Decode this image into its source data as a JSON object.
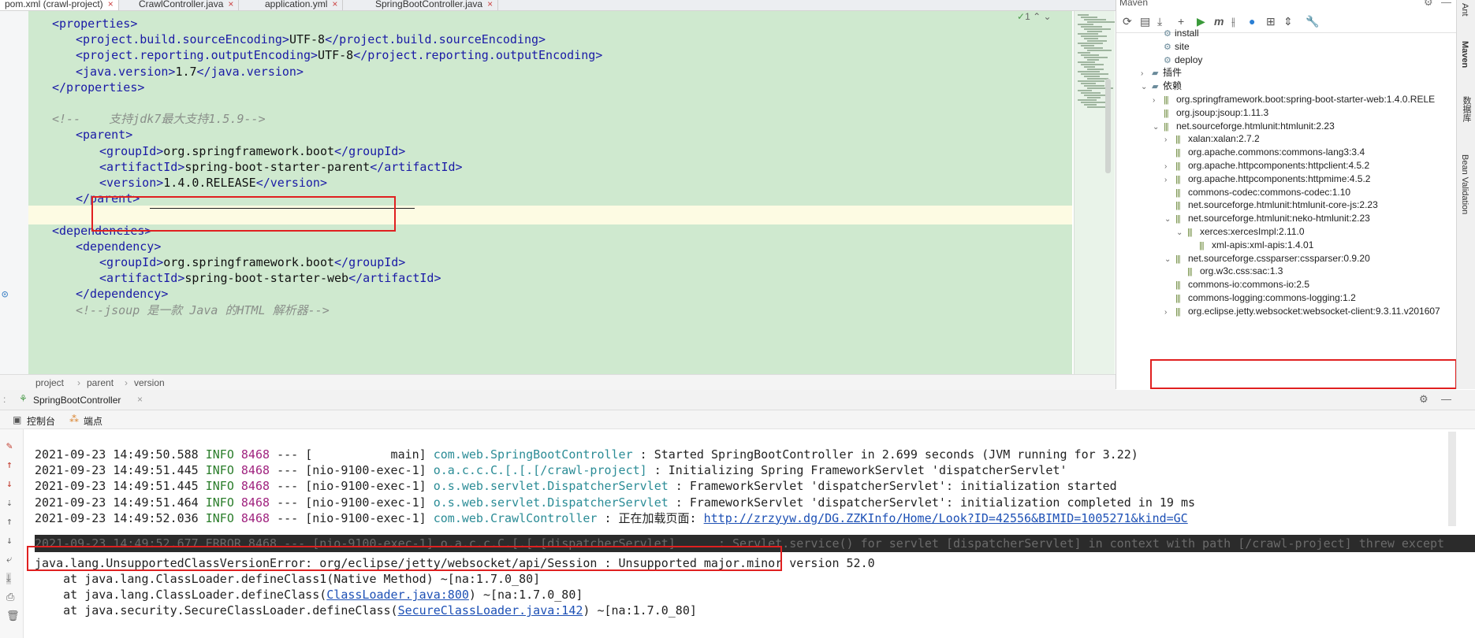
{
  "tabs": [
    {
      "label": "pom.xml (crawl-project)",
      "active": true
    },
    {
      "label": "CrawlController.java"
    },
    {
      "label": "application.yml"
    },
    {
      "label": "SpringBootController.java"
    }
  ],
  "editor": {
    "lines": [
      {
        "indent": 1,
        "open": "<properties>",
        "text": "",
        "close": ""
      },
      {
        "indent": 2,
        "open": "<project.build.sourceEncoding>",
        "text": "UTF-8",
        "close": "</project.build.sourceEncoding>"
      },
      {
        "indent": 2,
        "open": "<project.reporting.outputEncoding>",
        "text": "UTF-8",
        "close": "</project.reporting.outputEncoding>"
      },
      {
        "indent": 2,
        "open": "<java.version>",
        "text": "1.7",
        "close": "</java.version>"
      },
      {
        "indent": 1,
        "open": "</properties>",
        "text": "",
        "close": ""
      },
      {
        "indent": 0,
        "open": "",
        "text": "",
        "close": ""
      },
      {
        "indent": 1,
        "comment": "<!--    支持jdk7最大支持1.5.9-->"
      },
      {
        "indent": 2,
        "open": "<parent>",
        "text": "",
        "close": ""
      },
      {
        "indent": 3,
        "open": "<groupId>",
        "text": "org.springframework.boot",
        "close": "</groupId>"
      },
      {
        "indent": 3,
        "open": "<artifactId>",
        "text": "spring-boot-starter-parent",
        "close": "</artifactId>"
      },
      {
        "indent": 3,
        "open": "<version>",
        "text": "1.4.0.RELEASE",
        "close": "</version>"
      },
      {
        "indent": 2,
        "open": "</parent>",
        "text": "",
        "close": ""
      },
      {
        "indent": 0,
        "open": "",
        "text": "",
        "close": ""
      },
      {
        "indent": 1,
        "open": "<dependencies>",
        "text": "",
        "close": ""
      },
      {
        "indent": 2,
        "open": "<dependency>",
        "text": "",
        "close": ""
      },
      {
        "indent": 3,
        "open": "<groupId>",
        "text": "org.springframework.boot",
        "close": "</groupId>"
      },
      {
        "indent": 3,
        "open": "<artifactId>",
        "text": "spring-boot-starter-web",
        "close": "</artifactId>"
      },
      {
        "indent": 2,
        "open": "</dependency>",
        "text": "",
        "close": ""
      },
      {
        "indent": 2,
        "comment": "<!--jsoup 是一款 Java 的HTML 解析器-->"
      }
    ],
    "inspection": "1",
    "breadcrumb": [
      "project",
      "parent",
      "version"
    ]
  },
  "maven": {
    "title": "Maven",
    "items": [
      {
        "level": 2,
        "arrow": "",
        "icon": "gear",
        "label": "install"
      },
      {
        "level": 2,
        "arrow": "",
        "icon": "gear",
        "label": "site"
      },
      {
        "level": 2,
        "arrow": "",
        "icon": "gear",
        "label": "deploy"
      },
      {
        "level": 1,
        "arrow": ">",
        "icon": "folder",
        "label": "插件"
      },
      {
        "level": 1,
        "arrow": "v",
        "icon": "folder",
        "label": "依赖"
      },
      {
        "level": 2,
        "arrow": ">",
        "icon": "lib",
        "label": "org.springframework.boot:spring-boot-starter-web:1.4.0.RELE"
      },
      {
        "level": 2,
        "arrow": "",
        "icon": "lib",
        "label": "org.jsoup:jsoup:1.11.3"
      },
      {
        "level": 2,
        "arrow": "v",
        "icon": "lib",
        "label": "net.sourceforge.htmlunit:htmlunit:2.23"
      },
      {
        "level": 3,
        "arrow": ">",
        "icon": "lib",
        "label": "xalan:xalan:2.7.2"
      },
      {
        "level": 3,
        "arrow": "",
        "icon": "lib",
        "label": "org.apache.commons:commons-lang3:3.4"
      },
      {
        "level": 3,
        "arrow": ">",
        "icon": "lib",
        "label": "org.apache.httpcomponents:httpclient:4.5.2"
      },
      {
        "level": 3,
        "arrow": ">",
        "icon": "lib",
        "label": "org.apache.httpcomponents:httpmime:4.5.2"
      },
      {
        "level": 3,
        "arrow": "",
        "icon": "lib",
        "label": "commons-codec:commons-codec:1.10"
      },
      {
        "level": 3,
        "arrow": "",
        "icon": "lib",
        "label": "net.sourceforge.htmlunit:htmlunit-core-js:2.23"
      },
      {
        "level": 3,
        "arrow": "v",
        "icon": "lib",
        "label": "net.sourceforge.htmlunit:neko-htmlunit:2.23"
      },
      {
        "level": 4,
        "arrow": "v",
        "icon": "lib",
        "label": "xerces:xercesImpl:2.11.0"
      },
      {
        "level": 5,
        "arrow": "",
        "icon": "lib",
        "label": "xml-apis:xml-apis:1.4.01"
      },
      {
        "level": 3,
        "arrow": "v",
        "icon": "lib",
        "label": "net.sourceforge.cssparser:cssparser:0.9.20"
      },
      {
        "level": 4,
        "arrow": "",
        "icon": "lib",
        "label": "org.w3c.css:sac:1.3"
      },
      {
        "level": 3,
        "arrow": "",
        "icon": "lib",
        "label": "commons-io:commons-io:2.5"
      },
      {
        "level": 3,
        "arrow": "",
        "icon": "lib",
        "label": "commons-logging:commons-logging:1.2"
      },
      {
        "level": 3,
        "arrow": ">",
        "icon": "lib",
        "label": "org.eclipse.jetty.websocket:websocket-client:9.3.11.v201607"
      }
    ]
  },
  "rightStrip": [
    "Ant",
    "Maven",
    "数据库",
    "Bean Validation"
  ],
  "run": {
    "title": "SpringBootController",
    "tabs": [
      "控制台",
      "端点"
    ],
    "logs": [
      {
        "time": "2021-09-23 14:49:50.588",
        "level": "INFO",
        "pid": "8468",
        "sep": "---",
        "thread": "[           main]",
        "logger": "com.web.SpringBootController",
        "msg": ": Started SpringBootController in 2.699 seconds (JVM running for 3.22)"
      },
      {
        "time": "2021-09-23 14:49:51.445",
        "level": "INFO",
        "pid": "8468",
        "sep": "---",
        "thread": "[nio-9100-exec-1]",
        "logger": "o.a.c.c.C.[.[.[/crawl-project]",
        "msg": ": Initializing Spring FrameworkServlet 'dispatcherServlet'"
      },
      {
        "time": "2021-09-23 14:49:51.445",
        "level": "INFO",
        "pid": "8468",
        "sep": "---",
        "thread": "[nio-9100-exec-1]",
        "logger": "o.s.web.servlet.DispatcherServlet",
        "msg": ": FrameworkServlet 'dispatcherServlet': initialization started"
      },
      {
        "time": "2021-09-23 14:49:51.464",
        "level": "INFO",
        "pid": "8468",
        "sep": "---",
        "thread": "[nio-9100-exec-1]",
        "logger": "o.s.web.servlet.DispatcherServlet",
        "msg": ": FrameworkServlet 'dispatcherServlet': initialization completed in 19 ms"
      },
      {
        "time": "2021-09-23 14:49:52.036",
        "level": "INFO",
        "pid": "8468",
        "sep": "---",
        "thread": "[nio-9100-exec-1]",
        "logger": "com.web.CrawlController",
        "msg": ": 正在加载页面:",
        "link": "http://zrzyyw.dg/DG.ZZKInfo/Home/Look?ID=42556&BIMID=1005271&kind=GC"
      }
    ],
    "errorLine": "2021-09-23 14:49:52.677 ERROR 8468 --- [nio-9100-exec-1] o.a.c.c.C.[.[.[dispatcherServlet]      : Servlet.service() for servlet [dispatcherServlet] in context with path [/crawl-project] threw except",
    "exception": "java.lang.UnsupportedClassVersionError: org/eclipse/jetty/websocket/api/Session : Unsupported major.minor version 52.0",
    "stack": [
      {
        "prefix": "    at java.lang.ClassLoader.defineClass1(Native Method) ~[na:1.7.0_80]",
        "link": "",
        "suffix": ""
      },
      {
        "prefix": "    at java.lang.ClassLoader.defineClass(",
        "link": "ClassLoader.java:800",
        "suffix": ") ~[na:1.7.0_80]"
      },
      {
        "prefix": "    at java.security.SecureClassLoader.defineClass(",
        "link": "SecureClassLoader.java:142",
        "suffix": ") ~[na:1.7.0_80]"
      }
    ]
  },
  "colors": {
    "editorBg": "#cfe9cf",
    "highlight": "#e02020",
    "tag": "#1a1aa6"
  }
}
